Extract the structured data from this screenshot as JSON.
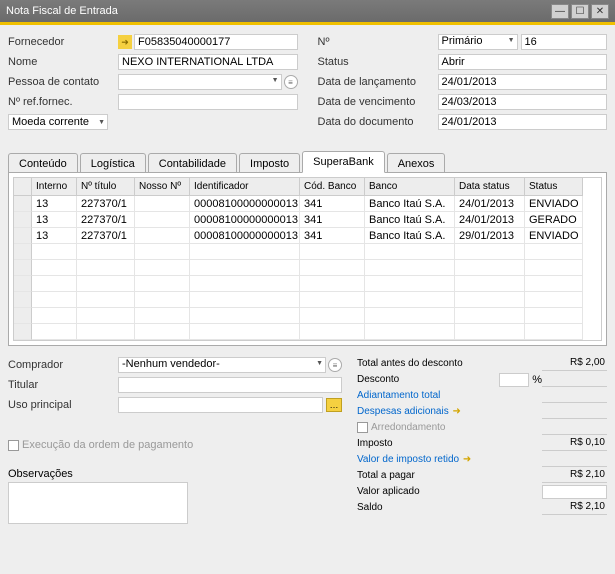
{
  "title": "Nota Fiscal de Entrada",
  "titlebar_icons": {
    "min": "—",
    "max": "☐",
    "close": "✕"
  },
  "top_left": {
    "fornecedor_label": "Fornecedor",
    "fornecedor_value": "F05835040000177",
    "nome_label": "Nome",
    "nome_value": "NEXO INTERNATIONAL LTDA",
    "pessoa_label": "Pessoa de contato",
    "pessoa_value": "",
    "refforn_label": "Nº ref.fornec.",
    "refforn_value": "",
    "moeda_label": "Moeda corrente"
  },
  "top_right": {
    "no_label": "Nº",
    "no_type": "Primário",
    "no_value": "16",
    "status_label": "Status",
    "status_value": "Abrir",
    "lancamento_label": "Data de lançamento",
    "lancamento_value": "24/01/2013",
    "vencimento_label": "Data de vencimento",
    "vencimento_value": "24/03/2013",
    "documento_label": "Data do documento",
    "documento_value": "24/01/2013"
  },
  "tabs": [
    "Conteúdo",
    "Logística",
    "Contabilidade",
    "Imposto",
    "SuperaBank",
    "Anexos"
  ],
  "active_tab_index": 4,
  "grid": {
    "headers": [
      "Interno",
      "Nº título",
      "Nosso Nº",
      "Identificador",
      "Cód. Banco",
      "Banco",
      "Data status",
      "Status"
    ],
    "rows": [
      {
        "interno": "13",
        "titulo": "227370/1",
        "nosso": "",
        "ident": "00008100000000013",
        "cod": "341",
        "banco": "Banco Itaú S.A.",
        "data": "24/01/2013",
        "status": "ENVIADO"
      },
      {
        "interno": "13",
        "titulo": "227370/1",
        "nosso": "",
        "ident": "00008100000000013",
        "cod": "341",
        "banco": "Banco Itaú S.A.",
        "data": "24/01/2013",
        "status": "GERADO"
      },
      {
        "interno": "13",
        "titulo": "227370/1",
        "nosso": "",
        "ident": "00008100000000013",
        "cod": "341",
        "banco": "Banco Itaú S.A.",
        "data": "29/01/2013",
        "status": "ENVIADO"
      }
    ],
    "empty_rows": 6
  },
  "bottom_left": {
    "comprador_label": "Comprador",
    "comprador_value": "-Nenhum vendedor-",
    "titular_label": "Titular",
    "titular_value": "",
    "uso_label": "Uso principal",
    "uso_value": "",
    "execucao_label": "Execução da ordem de pagamento",
    "obs_label": "Observações"
  },
  "totals": {
    "total_antes_label": "Total antes do desconto",
    "total_antes_value": "R$ 2,00",
    "desconto_label": "Desconto",
    "pct_label": "%",
    "adiantamento_label": "Adiantamento total",
    "despesas_label": "Despesas adicionais",
    "arredond_label": "Arredondamento",
    "imposto_label": "Imposto",
    "imposto_value": "R$ 0,10",
    "valor_ret_label": "Valor de imposto retido",
    "total_pagar_label": "Total a pagar",
    "total_pagar_value": "R$ 2,10",
    "valor_aplicado_label": "Valor aplicado",
    "saldo_label": "Saldo",
    "saldo_value": "R$ 2,10"
  }
}
